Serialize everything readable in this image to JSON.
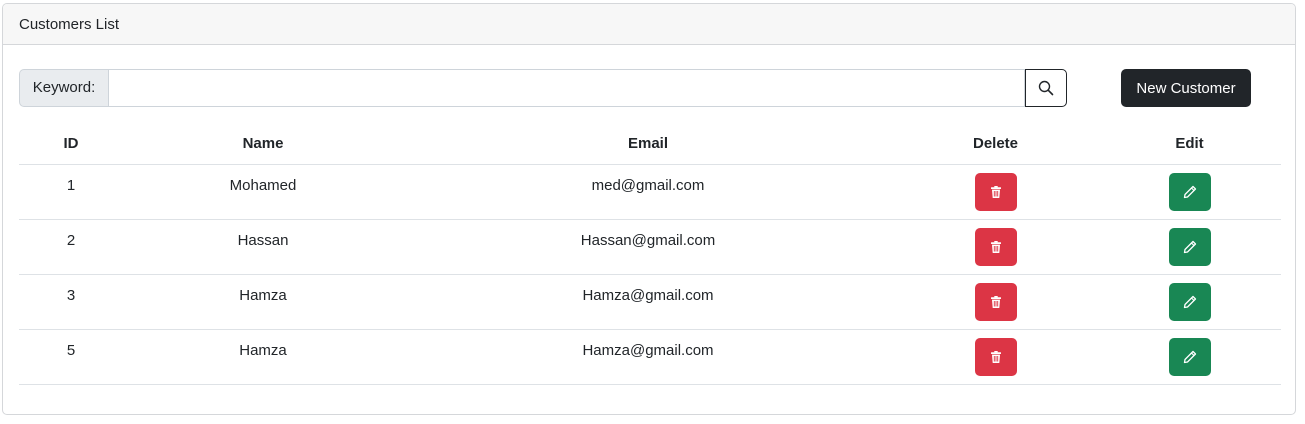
{
  "card": {
    "title": "Customers List"
  },
  "search": {
    "label": "Keyword:",
    "value": "",
    "placeholder": "",
    "icon": "search-icon"
  },
  "toolbar": {
    "new_customer_label": "New Customer"
  },
  "table": {
    "headers": {
      "id": "ID",
      "name": "Name",
      "email": "Email",
      "delete": "Delete",
      "edit": "Edit"
    },
    "rows": [
      {
        "id": "1",
        "name": "Mohamed",
        "email": "med@gmail.com"
      },
      {
        "id": "2",
        "name": "Hassan",
        "email": "Hassan@gmail.com"
      },
      {
        "id": "3",
        "name": "Hamza",
        "email": "Hamza@gmail.com"
      },
      {
        "id": "5",
        "name": "Hamza",
        "email": "Hamza@gmail.com"
      }
    ]
  },
  "colors": {
    "danger": "#dc3545",
    "success": "#198754",
    "dark": "#212529"
  },
  "icons": {
    "delete": "trash-icon",
    "edit": "pencil-icon"
  }
}
